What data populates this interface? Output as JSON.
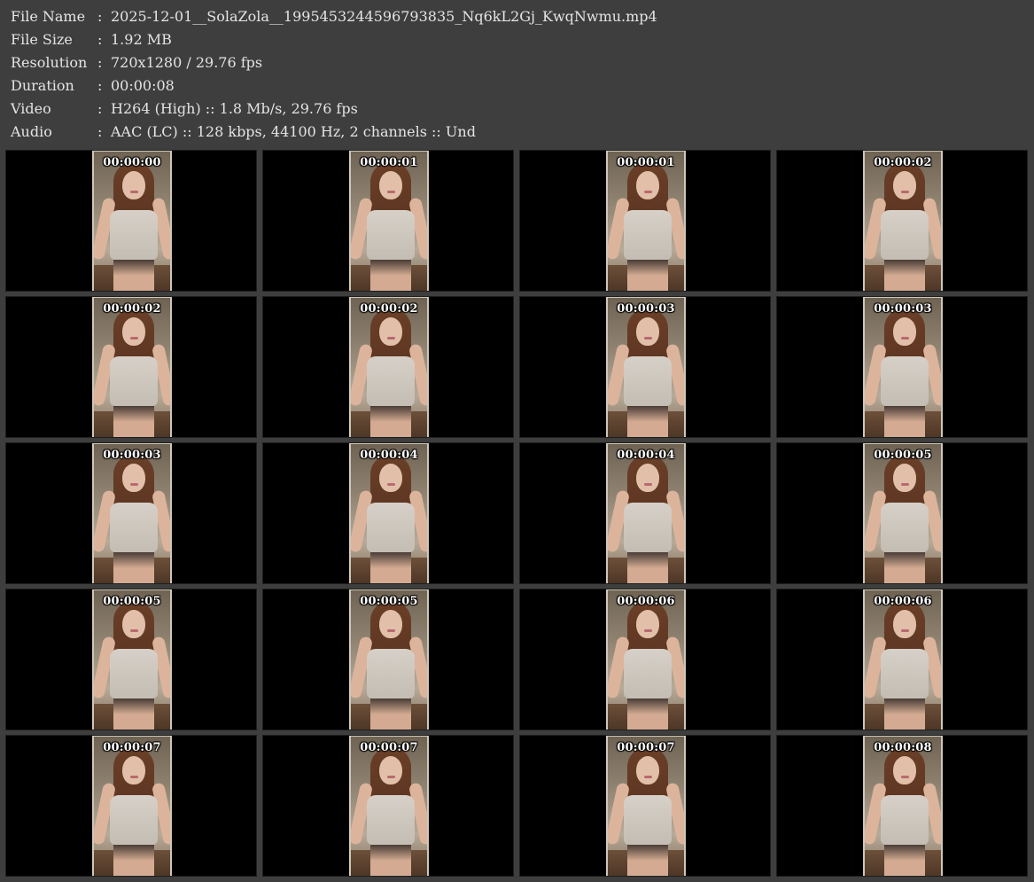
{
  "info": [
    {
      "label": "File Name",
      "sep": ":",
      "value": "2025-12-01__SolaZola__1995453244596793835_Nq6kL2Gj_KwqNwmu.mp4"
    },
    {
      "label": "File Size",
      "sep": ":",
      "value": "1.92 MB"
    },
    {
      "label": "Resolution",
      "sep": ":",
      "value": "720x1280 / 29.76 fps"
    },
    {
      "label": "Duration",
      "sep": ":",
      "value": "00:00:08"
    },
    {
      "label": "Video",
      "sep": ":",
      "value": "H264 (High) :: 1.8 Mb/s, 29.76 fps"
    },
    {
      "label": "Audio",
      "sep": ":",
      "value": "AAC (LC) :: 128 kbps, 44100 Hz, 2 channels :: Und"
    }
  ],
  "thumbnails": [
    {
      "timestamp": "00:00:00"
    },
    {
      "timestamp": "00:00:01"
    },
    {
      "timestamp": "00:00:01"
    },
    {
      "timestamp": "00:00:02"
    },
    {
      "timestamp": "00:00:02"
    },
    {
      "timestamp": "00:00:02"
    },
    {
      "timestamp": "00:00:03"
    },
    {
      "timestamp": "00:00:03"
    },
    {
      "timestamp": "00:00:03"
    },
    {
      "timestamp": "00:00:04"
    },
    {
      "timestamp": "00:00:04"
    },
    {
      "timestamp": "00:00:05"
    },
    {
      "timestamp": "00:00:05"
    },
    {
      "timestamp": "00:00:05"
    },
    {
      "timestamp": "00:00:06"
    },
    {
      "timestamp": "00:00:06"
    },
    {
      "timestamp": "00:00:07"
    },
    {
      "timestamp": "00:00:07"
    },
    {
      "timestamp": "00:00:07"
    },
    {
      "timestamp": "00:00:08"
    }
  ],
  "colors": {
    "background": "#3e3e3e",
    "text": "#e4e4e4",
    "cell": "#000000",
    "thumb_border": "#cfc7b9"
  }
}
